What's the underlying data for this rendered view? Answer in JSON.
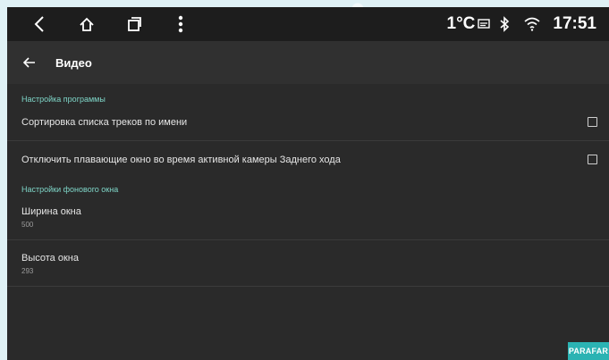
{
  "statusbar": {
    "temperature": "1°C",
    "time": "17:51",
    "icons": [
      "back-nav-icon",
      "home-icon",
      "recents-icon",
      "more-icon",
      "cast-icon",
      "bluetooth-icon",
      "wifi-icon"
    ]
  },
  "appbar": {
    "title": "Видео"
  },
  "sections": [
    {
      "header": "Настройка программы",
      "items": [
        {
          "label": "Сортировка списка треков по имени",
          "checked": false
        },
        {
          "label": "Отключить плавающие окно во время активной камеры Заднего хода",
          "checked": false
        }
      ]
    },
    {
      "header": "Настройки фонового окна",
      "items": [
        {
          "label": "Ширина окна",
          "value": "500"
        },
        {
          "label": "Высота окна",
          "value": "293"
        }
      ]
    }
  ],
  "watermark": "PARAFAR",
  "colors": {
    "accent": "#7fd6c8",
    "background": "#2a2a2a",
    "statusbar": "#1d1d1d",
    "appbar": "#303030"
  }
}
